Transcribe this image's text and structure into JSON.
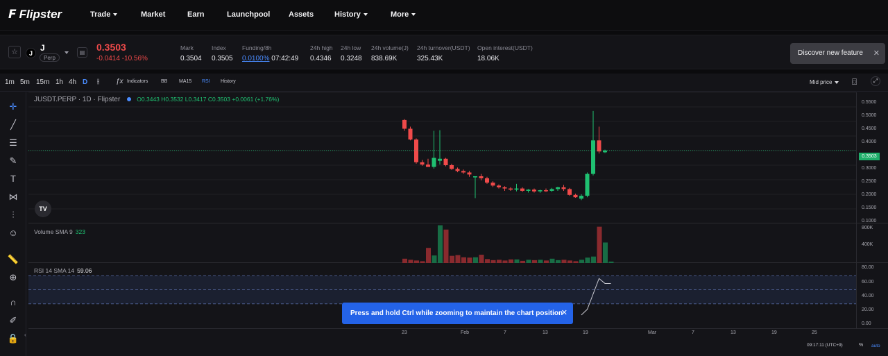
{
  "nav": {
    "brand": "Flipster",
    "items": [
      {
        "label": "Trade",
        "dropdown": true
      },
      {
        "label": "Market",
        "dropdown": false
      },
      {
        "label": "Earn",
        "dropdown": false
      },
      {
        "label": "Launchpool",
        "dropdown": false
      },
      {
        "label": "Assets",
        "dropdown": false
      },
      {
        "label": "History",
        "dropdown": true
      },
      {
        "label": "More",
        "dropdown": true
      }
    ]
  },
  "ticker": {
    "coin_icon_letter": "J",
    "symbol": "J",
    "tag": "Perp",
    "last_price": "0.3503",
    "change": "-0.0414 -10.56%",
    "stats": [
      {
        "label": "Mark",
        "value": "0.3504"
      },
      {
        "label": "Index",
        "value": "0.3505"
      },
      {
        "label": "Funding/8h",
        "value": "0.0100%",
        "extra": "07:42:49"
      },
      {
        "label": "24h high",
        "value": "0.4346"
      },
      {
        "label": "24h low",
        "value": "0.3248"
      },
      {
        "label": "24h volume(J)",
        "value": "838.69K"
      },
      {
        "label": "24h turnover(USDT)",
        "value": "325.43K"
      },
      {
        "label": "Open interest(USDT)",
        "value": "18.06K"
      }
    ],
    "discover": "Discover new feature"
  },
  "toolbar": {
    "timeframes": [
      "1m",
      "5m",
      "15m",
      "1h",
      "4h",
      "D"
    ],
    "active_timeframe": "D",
    "indicators_label": "Indicators",
    "studies": [
      "BB",
      "MA15",
      "RSI"
    ],
    "history_label": "History",
    "mid_price_label": "Mid price"
  },
  "legend": {
    "title": "JUSDT.PERP · 1D · Flipster",
    "ohlc": "O0.3443  H0.3532  L0.3417  C0.3503  +0.0061 (+1.76%)",
    "volume_label": "Volume SMA 9",
    "volume_value": "323",
    "rsi_label": "RSI 14 SMA 14",
    "rsi_value": "59.06"
  },
  "axes": {
    "price_ticks": [
      "0.5500",
      "0.5000",
      "0.4500",
      "0.4000",
      "0.3500",
      "0.3000",
      "0.2500",
      "0.2000",
      "0.1500",
      "0.1000"
    ],
    "current_price_tag": "0.3503",
    "volume_ticks": [
      "800K",
      "400K"
    ],
    "rsi_ticks": [
      "80.00",
      "60.00",
      "40.00",
      "20.00",
      "0.00"
    ],
    "x_ticks": [
      "23",
      "Feb",
      "7",
      "13",
      "19",
      "Mar",
      "7",
      "13",
      "19",
      "25"
    ]
  },
  "footer": {
    "time": "09:17:11 (UTC+9)",
    "pct": "%",
    "auto": "auto"
  },
  "toast": "Press and hold Ctrl while zooming to maintain the chart position",
  "colors": {
    "up": "#1fc071",
    "down": "#f04a4a",
    "accent": "#4a8cff",
    "toast": "#2463e8"
  },
  "chart_data": {
    "type": "candlestick",
    "ylim": [
      0.1,
      0.55
    ],
    "candles": [
      {
        "o": 0.455,
        "h": 0.458,
        "l": 0.418,
        "c": 0.425
      },
      {
        "o": 0.425,
        "h": 0.432,
        "l": 0.385,
        "c": 0.388
      },
      {
        "o": 0.388,
        "h": 0.392,
        "l": 0.305,
        "c": 0.31
      },
      {
        "o": 0.31,
        "h": 0.318,
        "l": 0.298,
        "c": 0.302
      },
      {
        "o": 0.302,
        "h": 0.322,
        "l": 0.295,
        "c": 0.294
      },
      {
        "o": 0.294,
        "h": 0.418,
        "l": 0.288,
        "c": 0.325
      },
      {
        "o": 0.315,
        "h": 0.42,
        "l": 0.302,
        "c": 0.322
      },
      {
        "o": 0.322,
        "h": 0.325,
        "l": 0.296,
        "c": 0.3
      },
      {
        "o": 0.3,
        "h": 0.305,
        "l": 0.284,
        "c": 0.287
      },
      {
        "o": 0.287,
        "h": 0.292,
        "l": 0.276,
        "c": 0.28
      },
      {
        "o": 0.28,
        "h": 0.285,
        "l": 0.27,
        "c": 0.275
      },
      {
        "o": 0.275,
        "h": 0.28,
        "l": 0.26,
        "c": 0.268
      },
      {
        "o": 0.258,
        "h": 0.262,
        "l": 0.187,
        "c": 0.262
      },
      {
        "o": 0.262,
        "h": 0.27,
        "l": 0.248,
        "c": 0.255
      },
      {
        "o": 0.255,
        "h": 0.26,
        "l": 0.236,
        "c": 0.24
      },
      {
        "o": 0.24,
        "h": 0.245,
        "l": 0.225,
        "c": 0.23
      },
      {
        "o": 0.23,
        "h": 0.234,
        "l": 0.22,
        "c": 0.224
      },
      {
        "o": 0.224,
        "h": 0.228,
        "l": 0.212,
        "c": 0.22
      },
      {
        "o": 0.22,
        "h": 0.224,
        "l": 0.212,
        "c": 0.216
      },
      {
        "o": 0.216,
        "h": 0.236,
        "l": 0.21,
        "c": 0.22
      },
      {
        "o": 0.22,
        "h": 0.224,
        "l": 0.208,
        "c": 0.212
      },
      {
        "o": 0.212,
        "h": 0.218,
        "l": 0.206,
        "c": 0.216
      },
      {
        "o": 0.216,
        "h": 0.22,
        "l": 0.206,
        "c": 0.21
      },
      {
        "o": 0.21,
        "h": 0.216,
        "l": 0.205,
        "c": 0.214
      },
      {
        "o": 0.214,
        "h": 0.22,
        "l": 0.208,
        "c": 0.212
      },
      {
        "o": 0.212,
        "h": 0.222,
        "l": 0.208,
        "c": 0.218
      },
      {
        "o": 0.218,
        "h": 0.226,
        "l": 0.212,
        "c": 0.224
      },
      {
        "o": 0.224,
        "h": 0.232,
        "l": 0.212,
        "c": 0.218
      },
      {
        "o": 0.218,
        "h": 0.222,
        "l": 0.195,
        "c": 0.198
      },
      {
        "o": 0.198,
        "h": 0.202,
        "l": 0.188,
        "c": 0.19
      },
      {
        "o": 0.185,
        "h": 0.2,
        "l": 0.18,
        "c": 0.195
      },
      {
        "o": 0.195,
        "h": 0.275,
        "l": 0.19,
        "c": 0.27
      },
      {
        "o": 0.27,
        "h": 0.486,
        "l": 0.265,
        "c": 0.385
      },
      {
        "o": 0.385,
        "h": 0.432,
        "l": 0.34,
        "c": 0.347
      },
      {
        "o": 0.3443,
        "h": 0.3532,
        "l": 0.3417,
        "c": 0.3503
      }
    ],
    "volume": [
      120,
      90,
      70,
      50,
      420,
      210,
      1050,
      930,
      200,
      220,
      160,
      150,
      160,
      230,
      110,
      80,
      90,
      70,
      100,
      100,
      60,
      90,
      80,
      90,
      70,
      120,
      80,
      90,
      70,
      50,
      90,
      150,
      180,
      1010,
      570,
      40
    ],
    "volume_ylim": [
      0,
      1100
    ],
    "rsi": [
      null,
      null,
      null,
      null,
      null,
      null,
      null,
      null,
      null,
      null,
      null,
      null,
      null,
      null,
      null,
      null,
      null,
      null,
      null,
      null,
      null,
      null,
      null,
      null,
      null,
      null,
      null,
      null,
      null,
      null,
      14,
      22,
      44,
      66,
      59,
      59
    ],
    "rsi_ylim": [
      0,
      80
    ],
    "rsi_bands": [
      30,
      50,
      70
    ]
  }
}
